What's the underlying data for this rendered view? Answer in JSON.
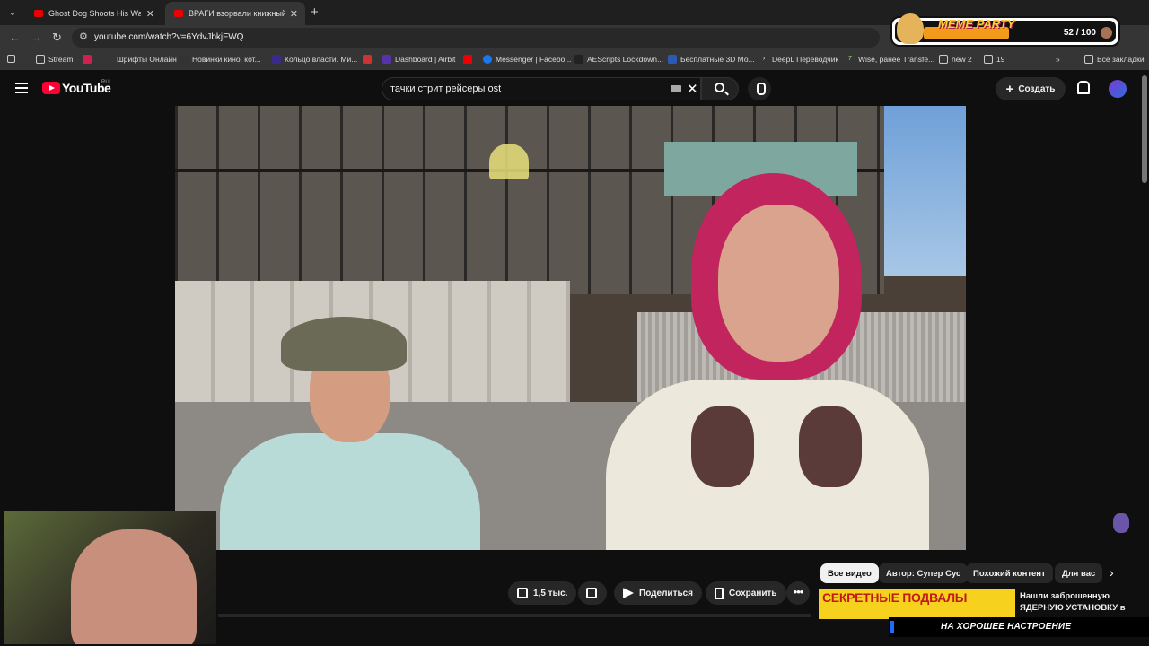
{
  "browser": {
    "tabs": [
      {
        "title": "Ghost Dog Shoots His Way Thr",
        "active": false
      },
      {
        "title": "ВРАГИ взорвали книжный Ры",
        "active": true
      }
    ],
    "url": "youtube.com/watch?v=6YdvJbkjFWQ",
    "bookmarks": [
      {
        "label": "Stream",
        "icon": "folder-icon"
      },
      {
        "label": "Шрифты Онлайн",
        "icon": "font-icon"
      },
      {
        "label": "Новинки кино, кот...",
        "icon": "film-icon"
      },
      {
        "label": "Кольцо власти. Ми...",
        "icon": "ring-icon"
      },
      {
        "label": "Dashboard | Airbit",
        "icon": "airbit-icon"
      },
      {
        "label": "Messenger | Facebo...",
        "icon": "facebook-icon"
      },
      {
        "label": "AEScripts Lockdown...",
        "icon": "aescripts-icon"
      },
      {
        "label": "Бесплатные 3D Мо...",
        "icon": "3d-icon"
      },
      {
        "label": "DeepL Переводчик",
        "icon": "deepl-icon"
      },
      {
        "label": "Wise, ранее Transfe...",
        "icon": "wise-icon"
      },
      {
        "label": "new 2",
        "icon": "folder-icon"
      },
      {
        "label": "19",
        "icon": "folder-icon"
      }
    ],
    "all_bookmarks": "Все закладки"
  },
  "meme_party": {
    "title": "MEME PARTY",
    "count": "52 / 100",
    "progress": 0.52
  },
  "youtube": {
    "logo": "YouTube",
    "region": "RU",
    "search_query": "тачки стрит рейсеры ost",
    "create_label": "Создать"
  },
  "actions": {
    "likes": "1,5 тыс.",
    "share": "Поделиться",
    "save": "Сохранить"
  },
  "chips": [
    "Все видео",
    "Автор: Супер Сус",
    "Похожий контент",
    "Для вас"
  ],
  "related": {
    "thumb_text": "СЕКРЕТНЫЕ ПОДВАЛЫ",
    "title": "Нашли заброшенную ЯДЕРНУЮ УСТАНОВКУ в"
  },
  "ticker": "НА ХОРОШЕЕ НАСТРОЕНИЕ",
  "colors": {
    "accent": "#ff0033",
    "meme_orange": "#f39a1a",
    "thumb_yellow": "#f6d21e"
  }
}
